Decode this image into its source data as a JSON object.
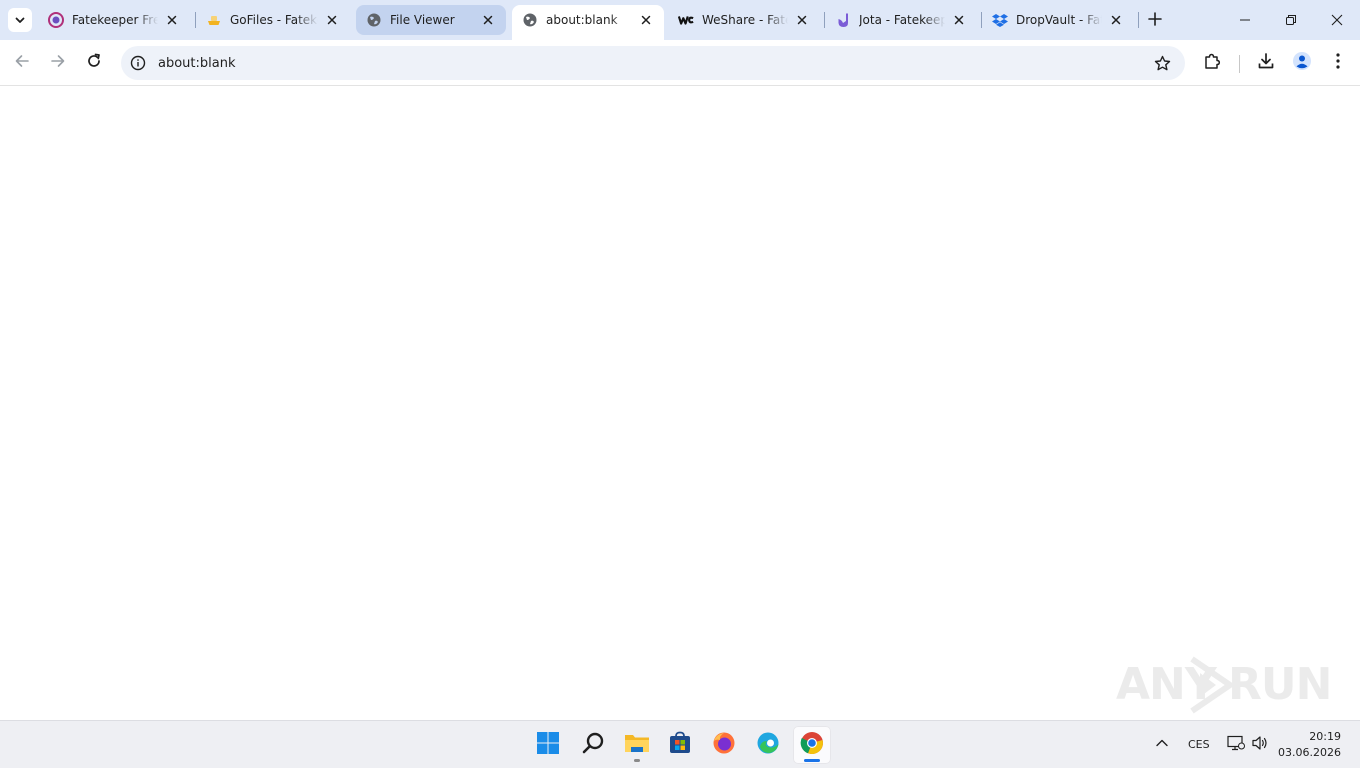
{
  "tabs": [
    {
      "title": "Fatekeeper Free",
      "favicon": "fatekeeper-icon",
      "state": "normal"
    },
    {
      "title": "GoFiles - Fatekeeper",
      "favicon": "gofiles-icon",
      "state": "normal"
    },
    {
      "title": "File Viewer",
      "favicon": "globe-icon",
      "state": "hovered"
    },
    {
      "title": "about:blank",
      "favicon": "globe-icon",
      "state": "active"
    },
    {
      "title": "WeShare - Fatekeeper",
      "favicon": "weshare-icon",
      "state": "normal"
    },
    {
      "title": "Jota - Fatekeeper",
      "favicon": "jota-icon",
      "state": "normal"
    },
    {
      "title": "DropVault - Fatekeeper",
      "favicon": "dropvault-icon",
      "state": "normal"
    }
  ],
  "address_bar": {
    "url": "about:blank"
  },
  "watermark": {
    "text_left": "ANY",
    "text_right": "RUN"
  },
  "taskbar": {
    "apps": [
      "windows-start-icon",
      "search-icon",
      "file-explorer-icon",
      "microsoft-store-icon",
      "firefox-icon",
      "edge-icon",
      "chrome-icon"
    ],
    "active_app": "chrome-icon"
  },
  "tray": {
    "language": "CES",
    "time": "20:19",
    "date": "03.06.2026"
  },
  "colors": {
    "tabstrip": "#dfe8f8",
    "active_tab": "#ffffff",
    "hovered_tab": "#c3d3ef",
    "omnibox": "#eef2f9",
    "taskbar": "#eeeff3",
    "accent": "#1a73e8"
  }
}
